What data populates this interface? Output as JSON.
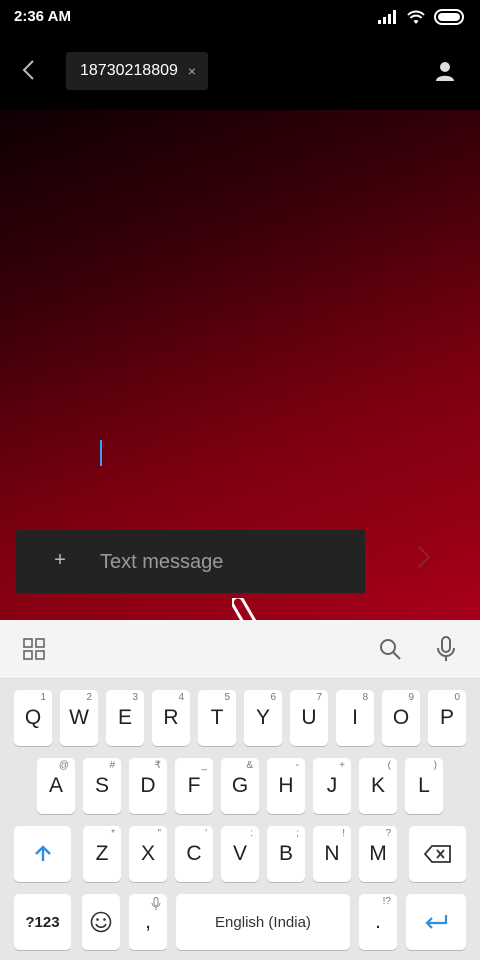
{
  "status_bar": {
    "time": "2:36 AM"
  },
  "header": {
    "recipient": "18730218809",
    "chip_close": "×"
  },
  "composer": {
    "attach": "+",
    "placeholder": "Text message"
  },
  "keyboard": {
    "row1": [
      {
        "key": "Q",
        "alt": "1"
      },
      {
        "key": "W",
        "alt": "2"
      },
      {
        "key": "E",
        "alt": "3"
      },
      {
        "key": "R",
        "alt": "4"
      },
      {
        "key": "T",
        "alt": "5"
      },
      {
        "key": "Y",
        "alt": "6"
      },
      {
        "key": "U",
        "alt": "7"
      },
      {
        "key": "I",
        "alt": "8"
      },
      {
        "key": "O",
        "alt": "9"
      },
      {
        "key": "P",
        "alt": "0"
      }
    ],
    "row2": [
      {
        "key": "A",
        "alt": "@"
      },
      {
        "key": "S",
        "alt": "#"
      },
      {
        "key": "D",
        "alt": "₹"
      },
      {
        "key": "F",
        "alt": "_"
      },
      {
        "key": "G",
        "alt": "&"
      },
      {
        "key": "H",
        "alt": "-"
      },
      {
        "key": "J",
        "alt": "+"
      },
      {
        "key": "K",
        "alt": "("
      },
      {
        "key": "L",
        "alt": ")"
      }
    ],
    "row3": [
      {
        "key": "Z",
        "alt": "*"
      },
      {
        "key": "X",
        "alt": "\""
      },
      {
        "key": "C",
        "alt": "'"
      },
      {
        "key": "V",
        "alt": ":"
      },
      {
        "key": "B",
        "alt": ";"
      },
      {
        "key": "N",
        "alt": "!"
      },
      {
        "key": "M",
        "alt": "?"
      }
    ],
    "symbols_label": "?123",
    "comma": ",",
    "space_label": "English (India)",
    "period": ".",
    "period_alt": "!?"
  }
}
